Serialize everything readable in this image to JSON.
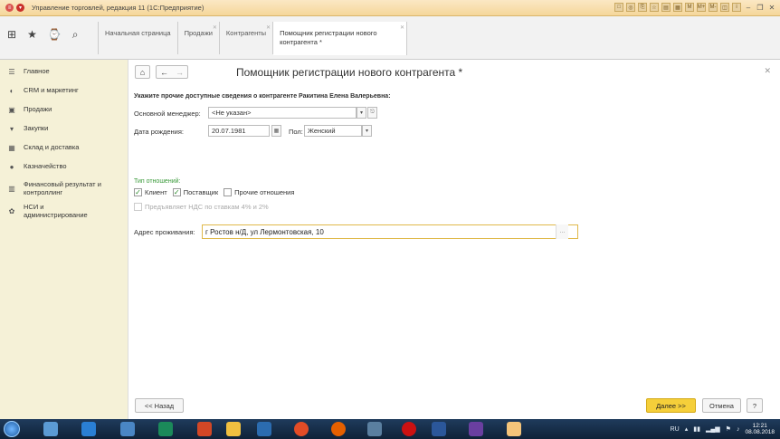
{
  "window": {
    "title": "Управление торговлей, редакция 11 (1С:Предприятие)"
  },
  "tabs": [
    {
      "label": "Начальная страница"
    },
    {
      "label": "Продажи"
    },
    {
      "label": "Контрагенты"
    },
    {
      "label": "Помощник регистрации нового контрагента *"
    }
  ],
  "sidebar": {
    "items": [
      {
        "label": "Главное",
        "icon": "menu-icon"
      },
      {
        "label": "CRM и маркетинг",
        "icon": "crm-icon"
      },
      {
        "label": "Продажи",
        "icon": "sales-bag-icon"
      },
      {
        "label": "Закупки",
        "icon": "cart-icon"
      },
      {
        "label": "Склад и доставка",
        "icon": "warehouse-icon"
      },
      {
        "label": "Казначейство",
        "icon": "treasury-icon"
      },
      {
        "label": "Финансовый результат и контроллинг",
        "icon": "chart-icon"
      },
      {
        "label": "НСИ и администрирование",
        "icon": "gear-icon"
      }
    ]
  },
  "form": {
    "title": "Помощник регистрации нового контрагента *",
    "note": "Укажите прочие доступные сведения о контрагенте Ракитина Елена Валерьевна:",
    "manager_label": "Основной менеджер:",
    "manager_value": "<Не указан>",
    "birth_label": "Дата рождения:",
    "birth_value": "20.07.1981",
    "gender_label": "Пол:",
    "gender_value": "Женский",
    "relation_label": "Тип отношений:",
    "client_label": "Клиент",
    "client_checked": true,
    "supplier_label": "Поставщик",
    "supplier_checked": true,
    "other_label": "Прочие отношения",
    "other_checked": false,
    "vat_label": "Предъявляет НДС по ставкам 4% и 2%",
    "address_label": "Адрес проживания:",
    "address_value": "г Ростов н/Д, ул Лермонтовская, 10",
    "back_label": "<< Назад",
    "next_label": "Далее >>",
    "cancel_label": "Отмена",
    "help_label": "?"
  },
  "taskbar": {
    "lang": "RU",
    "time": "12:21",
    "date": "08.08.2018"
  }
}
